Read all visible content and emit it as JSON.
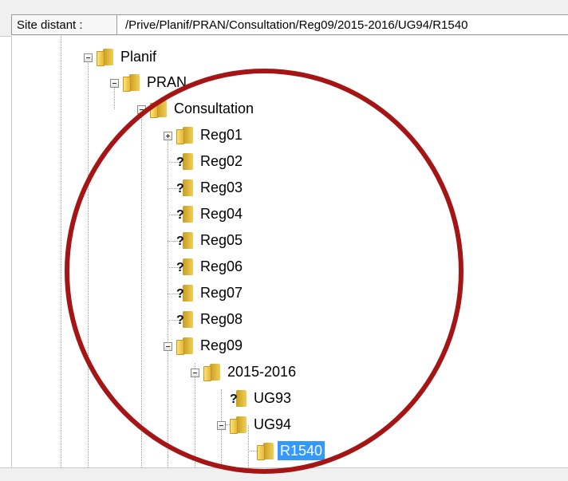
{
  "header": {
    "site_label": "Site distant :",
    "path_value": "/Prive/Planif/PRAN/Consultation/Reg09/2015-2016/UG94/R1540"
  },
  "tree": [
    {
      "label": "Planif",
      "expander": "minus",
      "icon": "folder"
    },
    {
      "label": "PRAN",
      "expander": "minus",
      "icon": "folder"
    },
    {
      "label": "Consultation",
      "expander": "minus",
      "icon": "folder"
    },
    {
      "label": "Reg01",
      "expander": "plus",
      "icon": "folder"
    },
    {
      "label": "Reg02",
      "expander": "none",
      "icon": "folder-unknown"
    },
    {
      "label": "Reg03",
      "expander": "none",
      "icon": "folder-unknown"
    },
    {
      "label": "Reg04",
      "expander": "none",
      "icon": "folder-unknown"
    },
    {
      "label": "Reg05",
      "expander": "none",
      "icon": "folder-unknown"
    },
    {
      "label": "Reg06",
      "expander": "none",
      "icon": "folder-unknown"
    },
    {
      "label": "Reg07",
      "expander": "none",
      "icon": "folder-unknown"
    },
    {
      "label": "Reg08",
      "expander": "none",
      "icon": "folder-unknown"
    },
    {
      "label": "Reg09",
      "expander": "minus",
      "icon": "folder"
    },
    {
      "label": "2015-2016",
      "expander": "minus",
      "icon": "folder"
    },
    {
      "label": "UG93",
      "expander": "none",
      "icon": "folder-unknown"
    },
    {
      "label": "UG94",
      "expander": "minus",
      "icon": "folder"
    },
    {
      "label": "R1540",
      "expander": "none",
      "icon": "folder",
      "selected": true
    }
  ],
  "colors": {
    "selection": "#3399ff",
    "annotation_circle": "#a51515",
    "folder": "#f1cf54"
  }
}
